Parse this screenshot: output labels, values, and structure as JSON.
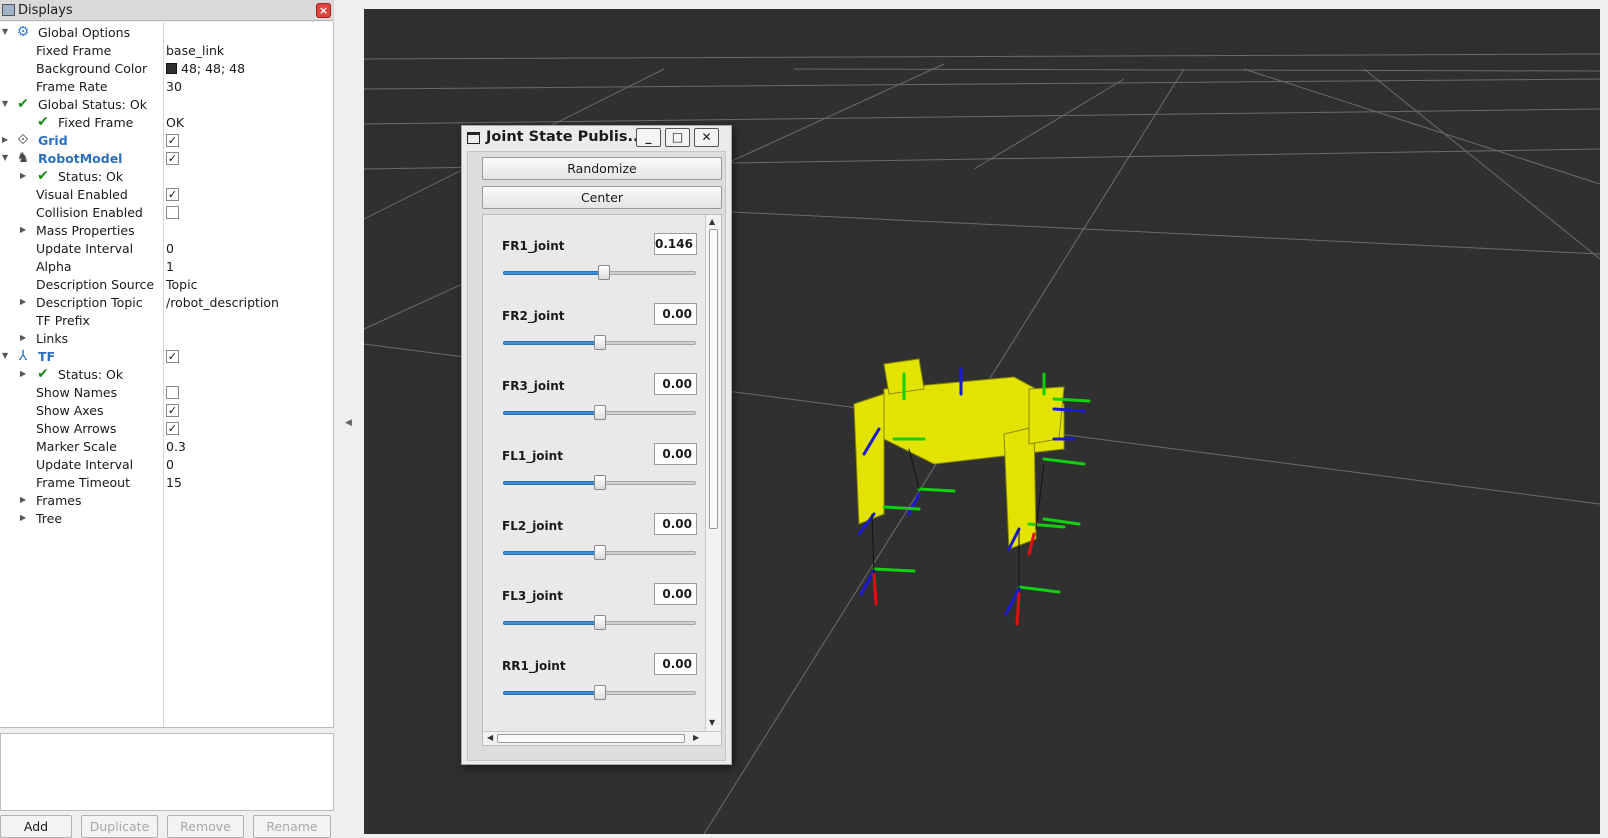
{
  "displays": {
    "title": "Displays",
    "rows": [
      {
        "label": "Global Options",
        "value": ""
      },
      {
        "label": "Fixed Frame",
        "value": "base_link"
      },
      {
        "label": "Background Color",
        "value": "48; 48; 48"
      },
      {
        "label": "Frame Rate",
        "value": "30"
      },
      {
        "label": "Global Status: Ok",
        "value": ""
      },
      {
        "label": "Fixed Frame",
        "value": "OK"
      },
      {
        "label": "Grid",
        "value": ""
      },
      {
        "label": "RobotModel",
        "value": ""
      },
      {
        "label": "Status: Ok",
        "value": ""
      },
      {
        "label": "Visual Enabled",
        "value": ""
      },
      {
        "label": "Collision Enabled",
        "value": ""
      },
      {
        "label": "Mass Properties",
        "value": ""
      },
      {
        "label": "Update Interval",
        "value": "0"
      },
      {
        "label": "Alpha",
        "value": "1"
      },
      {
        "label": "Description Source",
        "value": "Topic"
      },
      {
        "label": "Description Topic",
        "value": "/robot_description"
      },
      {
        "label": "TF Prefix",
        "value": ""
      },
      {
        "label": "Links",
        "value": ""
      },
      {
        "label": "TF",
        "value": ""
      },
      {
        "label": "Status: Ok",
        "value": ""
      },
      {
        "label": "Show Names",
        "value": ""
      },
      {
        "label": "Show Axes",
        "value": ""
      },
      {
        "label": "Show Arrows",
        "value": ""
      },
      {
        "label": "Marker Scale",
        "value": "0.3"
      },
      {
        "label": "Update Interval",
        "value": "0"
      },
      {
        "label": "Frame Timeout",
        "value": "15"
      },
      {
        "label": "Frames",
        "value": ""
      },
      {
        "label": "Tree",
        "value": ""
      }
    ],
    "checkboxes": {
      "grid": true,
      "robotmodel": true,
      "visual_enabled": true,
      "collision_enabled": false,
      "tf": true,
      "show_names": false,
      "show_axes": true,
      "show_arrows": true
    },
    "background_color_hex": "#303030",
    "buttons": {
      "add": "Add",
      "duplicate": "Duplicate",
      "remove": "Remove",
      "rename": "Rename"
    }
  },
  "joint_state_publisher": {
    "title": "Joint State Publis...",
    "randomize_label": "Randomize",
    "center_label": "Center",
    "joints": [
      {
        "name": "FR1_joint",
        "value": "0.146",
        "position_fraction": 0.523
      },
      {
        "name": "FR2_joint",
        "value": "0.00",
        "position_fraction": 0.5
      },
      {
        "name": "FR3_joint",
        "value": "0.00",
        "position_fraction": 0.5
      },
      {
        "name": "FL1_joint",
        "value": "0.00",
        "position_fraction": 0.5
      },
      {
        "name": "FL2_joint",
        "value": "0.00",
        "position_fraction": 0.5
      },
      {
        "name": "FL3_joint",
        "value": "0.00",
        "position_fraction": 0.5
      },
      {
        "name": "RR1_joint",
        "value": "0.00",
        "position_fraction": 0.5
      }
    ]
  },
  "colors": {
    "viewport_bg": "#303030",
    "robot_body": "#e6e600",
    "axis_x": "#e01010",
    "axis_y": "#10d010",
    "axis_z": "#1020d0",
    "accent_blue": "#2b6fbf",
    "ok_green": "#1a8a1a"
  }
}
